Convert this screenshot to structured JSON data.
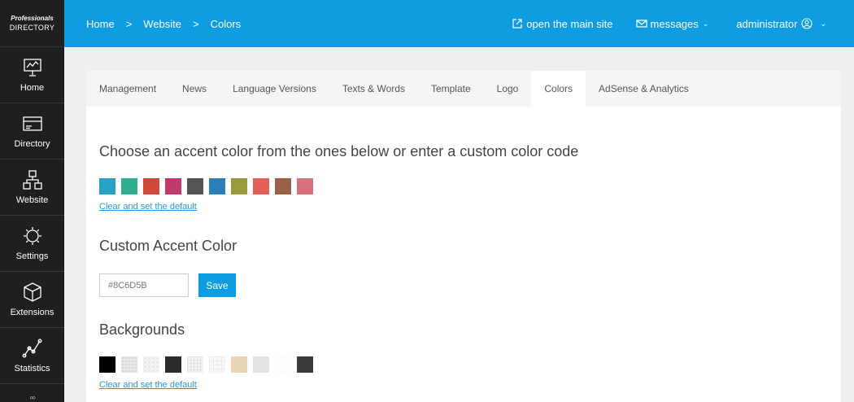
{
  "brand": {
    "line1": "Professionals",
    "line2": "DIRECTORY"
  },
  "sidebar": {
    "items": [
      {
        "label": "Home",
        "icon": "presentation-icon"
      },
      {
        "label": "Directory",
        "icon": "card-icon"
      },
      {
        "label": "Website",
        "icon": "sitemap-icon"
      },
      {
        "label": "Settings",
        "icon": "gear-icon"
      },
      {
        "label": "Extensions",
        "icon": "cube-icon"
      },
      {
        "label": "Statistics",
        "icon": "line-chart-icon"
      },
      {
        "label": "",
        "icon": "users-icon"
      }
    ]
  },
  "header": {
    "breadcrumb": [
      "Home",
      "Website",
      "Colors"
    ],
    "separator": ">",
    "open_site": "open the main site",
    "messages": "messages",
    "admin": "administrator",
    "chevron": "⌄"
  },
  "tabs": [
    {
      "label": "Management",
      "active": false
    },
    {
      "label": "News",
      "active": false
    },
    {
      "label": "Language Versions",
      "active": false
    },
    {
      "label": "Texts & Words",
      "active": false
    },
    {
      "label": "Template",
      "active": false
    },
    {
      "label": "Logo",
      "active": false
    },
    {
      "label": "Colors",
      "active": true
    },
    {
      "label": "AdSense & Analytics",
      "active": false
    }
  ],
  "accent": {
    "title": "Choose an accent color from the ones below or enter a custom color code",
    "colors": [
      "#2aa2c4",
      "#2eaf8f",
      "#d04a3b",
      "#c13a6e",
      "#555555",
      "#2b7fb8",
      "#9a9a3a",
      "#e35f58",
      "#9a6048",
      "#d8707a"
    ],
    "clear_label": "Clear and set the default"
  },
  "custom": {
    "title": "Custom Accent Color",
    "value": "#8C6D5B",
    "save_label": "Save"
  },
  "backgrounds": {
    "title": "Backgrounds",
    "swatches": [
      "#000000",
      "pattern-dots",
      "pattern-light",
      "#2b2b2b",
      "pattern-grid",
      "pattern-grid-light",
      "#ead6b6",
      "#e2e2e2",
      "#fdfdfd",
      "#3a3a3a"
    ],
    "clear_label": "Clear and set the default"
  }
}
